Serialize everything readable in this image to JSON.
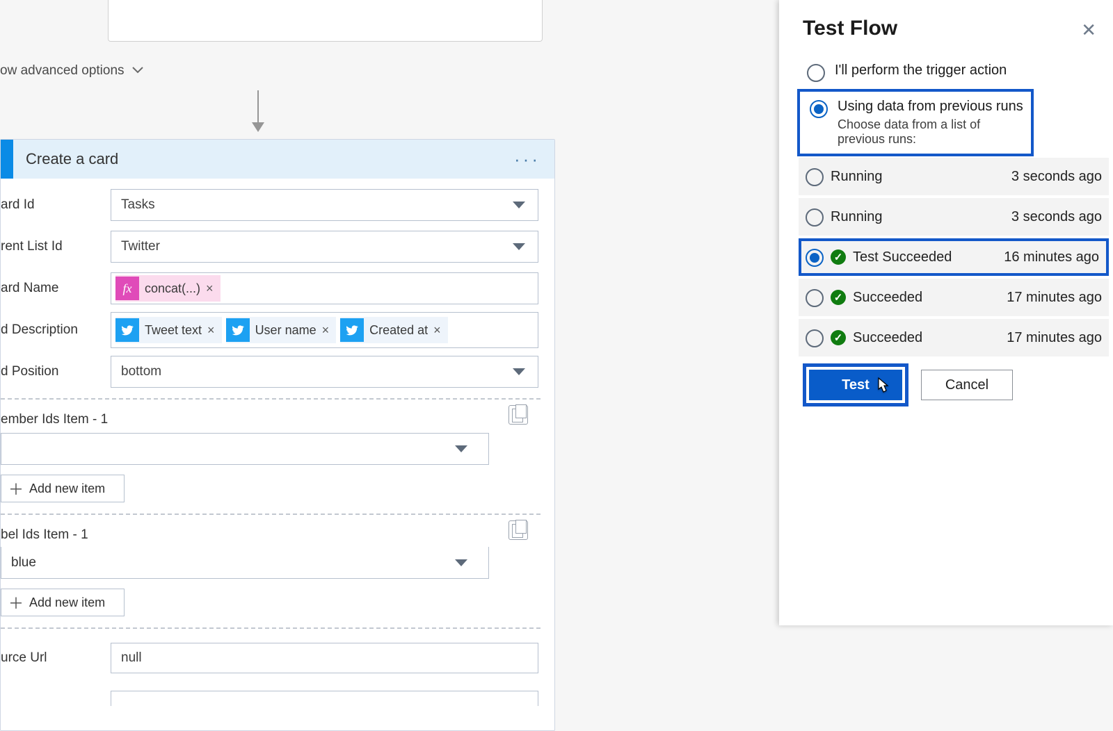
{
  "canvas": {
    "adv_options_label": "ow advanced options"
  },
  "action": {
    "title": "Create a card",
    "fields": {
      "board_id": {
        "label": "ard Id",
        "value": "Tasks"
      },
      "parent_list_id": {
        "label": "rent List Id",
        "value": "Twitter"
      },
      "card_name": {
        "label": "ard Name",
        "tokens": [
          {
            "type": "fx",
            "label": "concat(...)"
          }
        ]
      },
      "card_description": {
        "label": "d Description",
        "tokens": [
          {
            "type": "twitter",
            "label": "Tweet text"
          },
          {
            "type": "twitter",
            "label": "User name"
          },
          {
            "type": "twitter",
            "label": "Created at"
          }
        ]
      },
      "card_position": {
        "label": "d Position",
        "value": "bottom"
      },
      "member_ids_header": "ember Ids Item - 1",
      "label_ids_header": "bel Ids Item - 1",
      "label_ids_value": "blue",
      "add_item_label": "Add new item",
      "source_url": {
        "label": "urce Url",
        "value": "null"
      }
    }
  },
  "panel": {
    "title": "Test Flow",
    "options": {
      "manual": "I'll perform the trigger action",
      "previous": "Using data from previous runs",
      "previous_sub": "Choose data from a list of previous runs:"
    },
    "runs": [
      {
        "status": "Running",
        "ok": false,
        "time": "3 seconds ago",
        "selected": false
      },
      {
        "status": "Running",
        "ok": false,
        "time": "3 seconds ago",
        "selected": false
      },
      {
        "status": "Test Succeeded",
        "ok": true,
        "time": "16 minutes ago",
        "selected": true
      },
      {
        "status": "Succeeded",
        "ok": true,
        "time": "17 minutes ago",
        "selected": false
      },
      {
        "status": "Succeeded",
        "ok": true,
        "time": "17 minutes ago",
        "selected": false
      }
    ],
    "test_button": "Test",
    "cancel_button": "Cancel"
  }
}
